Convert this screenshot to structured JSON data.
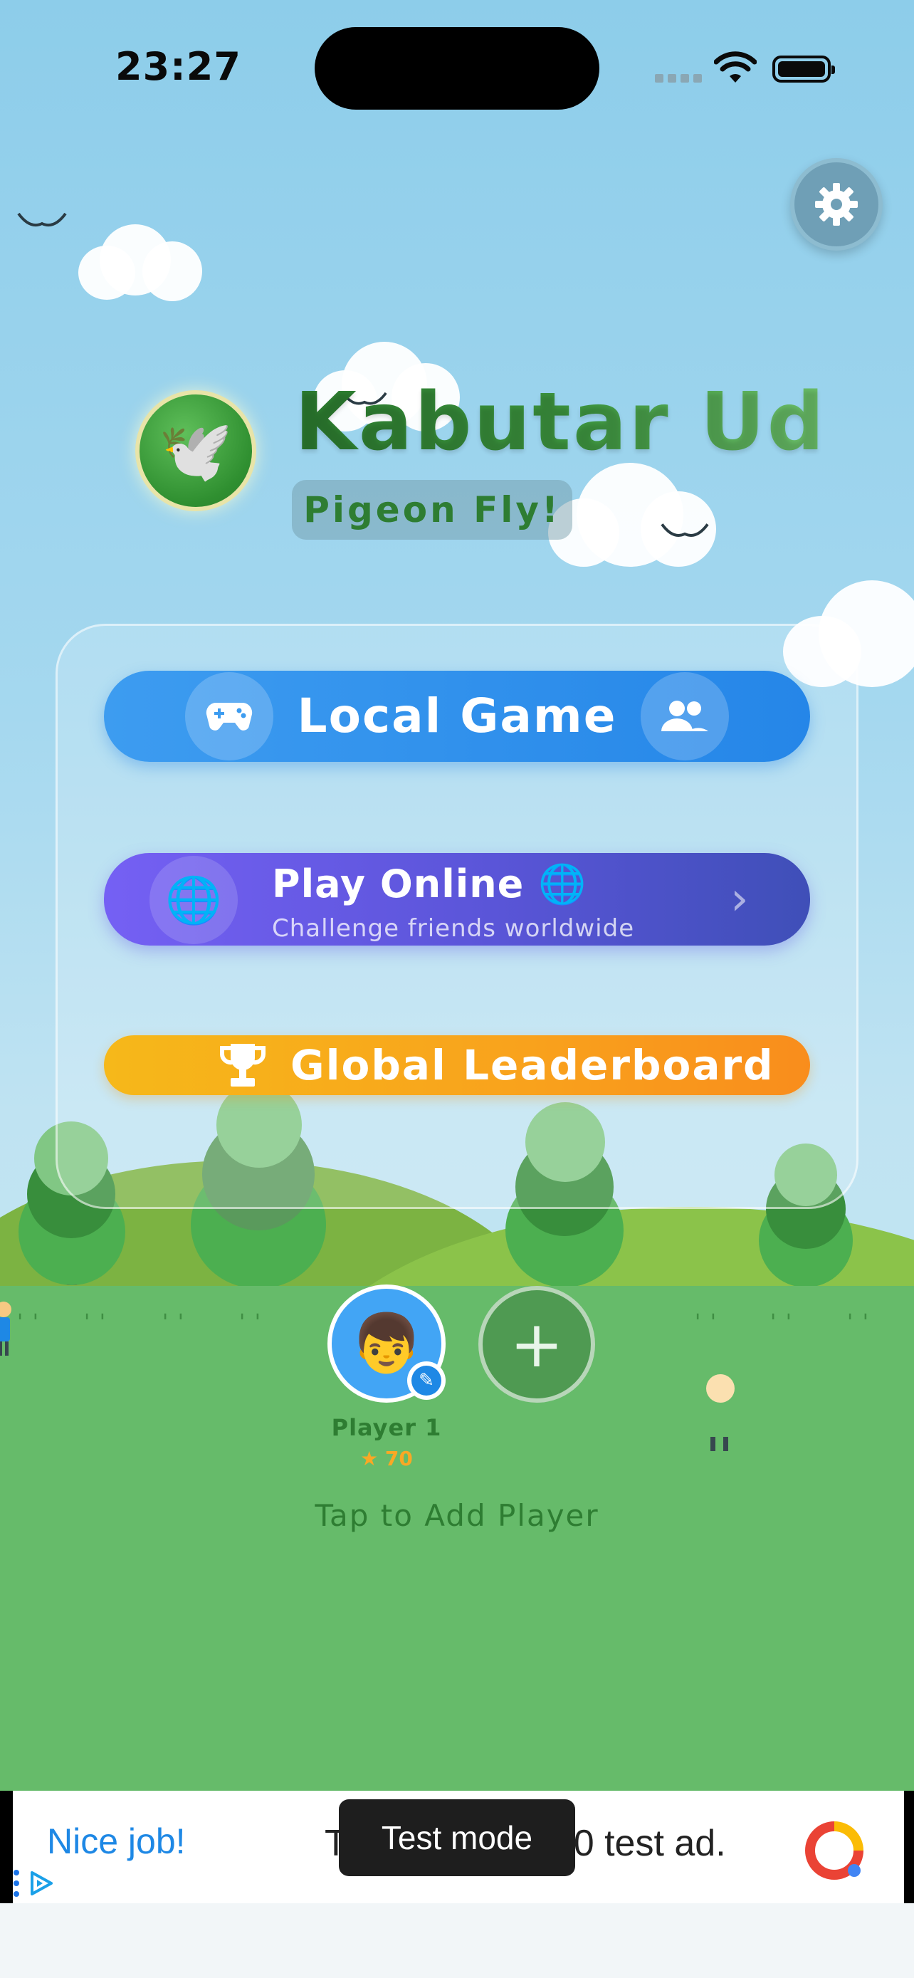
{
  "status_bar": {
    "time": "23:27"
  },
  "app": {
    "title": "Kabutar Ud",
    "subtitle": "Pigeon Fly!",
    "logo_icon": "🕊️"
  },
  "menu": {
    "local_game": {
      "label": "Local Game",
      "left_icon": "gamepad-icon",
      "right_icon": "people-icon"
    },
    "play_online": {
      "label": "Play Online 🌐",
      "sublabel": "Challenge friends worldwide",
      "icon": "🌐"
    },
    "leaderboard": {
      "label": "Global Leaderboard",
      "icon": "trophy-icon"
    }
  },
  "players": [
    {
      "name": "Player 1",
      "score": "★ 70",
      "avatar": "👦"
    }
  ],
  "add_player": {
    "symbol": "+",
    "hint": "Tap to Add Player"
  },
  "ad": {
    "headline": "Nice job!",
    "body": "This is a 320x50 test ad.",
    "toast": "Test mode"
  },
  "colors": {
    "sky": "#8dcdea",
    "grass": "#66bb6a",
    "local_button": "#2586e8",
    "online_button": "#5a55d8",
    "leaderboard_button": "#f9a21c",
    "title_green": "#2b7a2e"
  }
}
